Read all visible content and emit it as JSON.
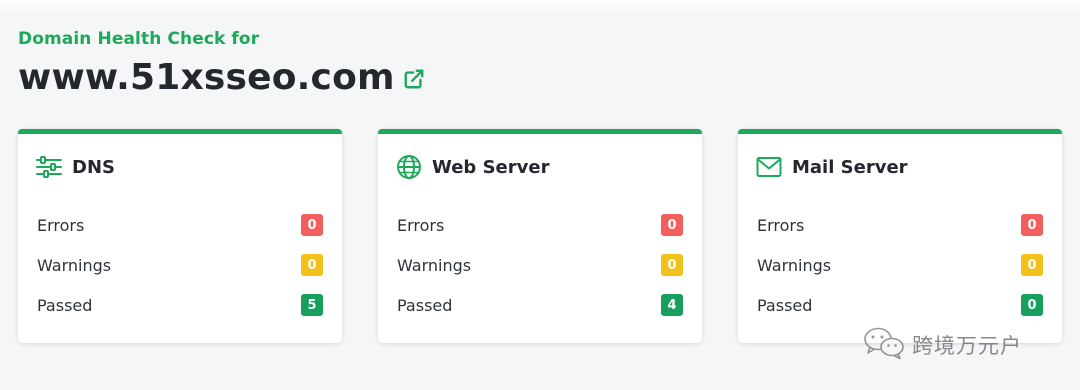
{
  "header": {
    "subtitle": "Domain Health Check for",
    "domain": "www.51xsseo.com",
    "link_icon": "external-link-icon"
  },
  "colors": {
    "accent": "#1ea85a",
    "error": "#f25f5c",
    "warning": "#f2c21a",
    "passed": "#17a05d"
  },
  "cards": [
    {
      "title": "DNS",
      "icon": "sliders-icon",
      "rows": [
        {
          "label": "Errors",
          "count": "0"
        },
        {
          "label": "Warnings",
          "count": "0"
        },
        {
          "label": "Passed",
          "count": "5"
        }
      ]
    },
    {
      "title": "Web Server",
      "icon": "globe-icon",
      "rows": [
        {
          "label": "Errors",
          "count": "0"
        },
        {
          "label": "Warnings",
          "count": "0"
        },
        {
          "label": "Passed",
          "count": "4"
        }
      ]
    },
    {
      "title": "Mail Server",
      "icon": "envelope-icon",
      "rows": [
        {
          "label": "Errors",
          "count": "0"
        },
        {
          "label": "Warnings",
          "count": "0"
        },
        {
          "label": "Passed",
          "count": "0"
        }
      ]
    }
  ],
  "watermark": {
    "text": "跨境万元户",
    "icon": "wechat-icon"
  }
}
